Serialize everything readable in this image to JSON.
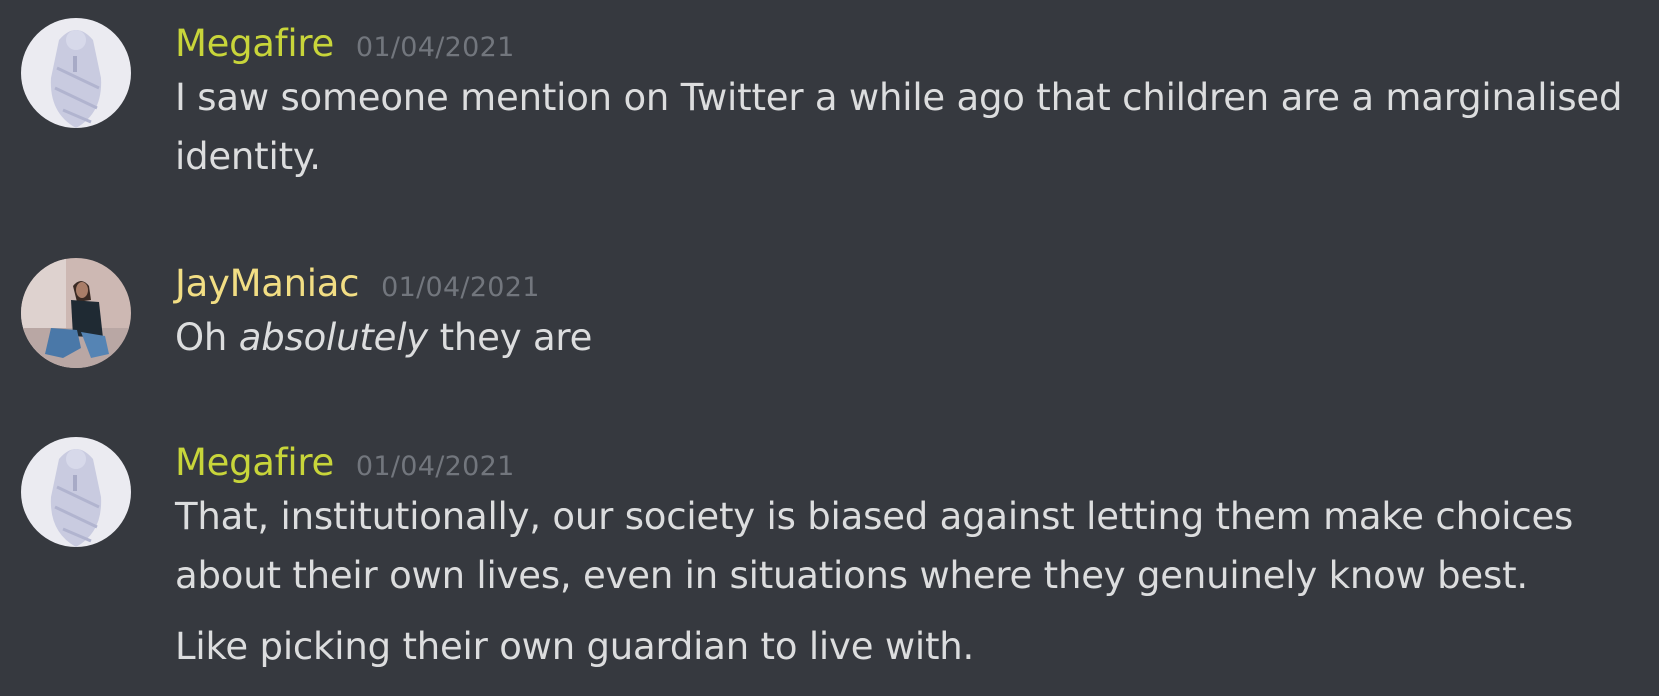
{
  "messages": [
    {
      "username": "Megafire",
      "timestamp": "01/04/2021",
      "avatar_icon": "baby-avatar-icon",
      "name_color": "#c8d53a",
      "lines": [
        "I saw someone mention on Twitter a while ago that children are a marginalised identity."
      ]
    },
    {
      "username": "JayManiac",
      "timestamp": "01/04/2021",
      "avatar_icon": "photo-avatar-icon",
      "name_color": "#f2de84",
      "lines": [
        {
          "before": "Oh ",
          "emphasis": "absolutely",
          "after": " they are"
        }
      ]
    },
    {
      "username": "Megafire",
      "timestamp": "01/04/2021",
      "avatar_icon": "baby-avatar-icon",
      "name_color": "#c8d53a",
      "lines": [
        "That, institutionally, our society is biased against letting them make choices about their own lives, even in situations where they genuinely know best.",
        "Like picking their own guardian to live with."
      ]
    }
  ],
  "colors": {
    "background": "#36393f",
    "text": "#dcddde",
    "timestamp": "#72767d"
  }
}
